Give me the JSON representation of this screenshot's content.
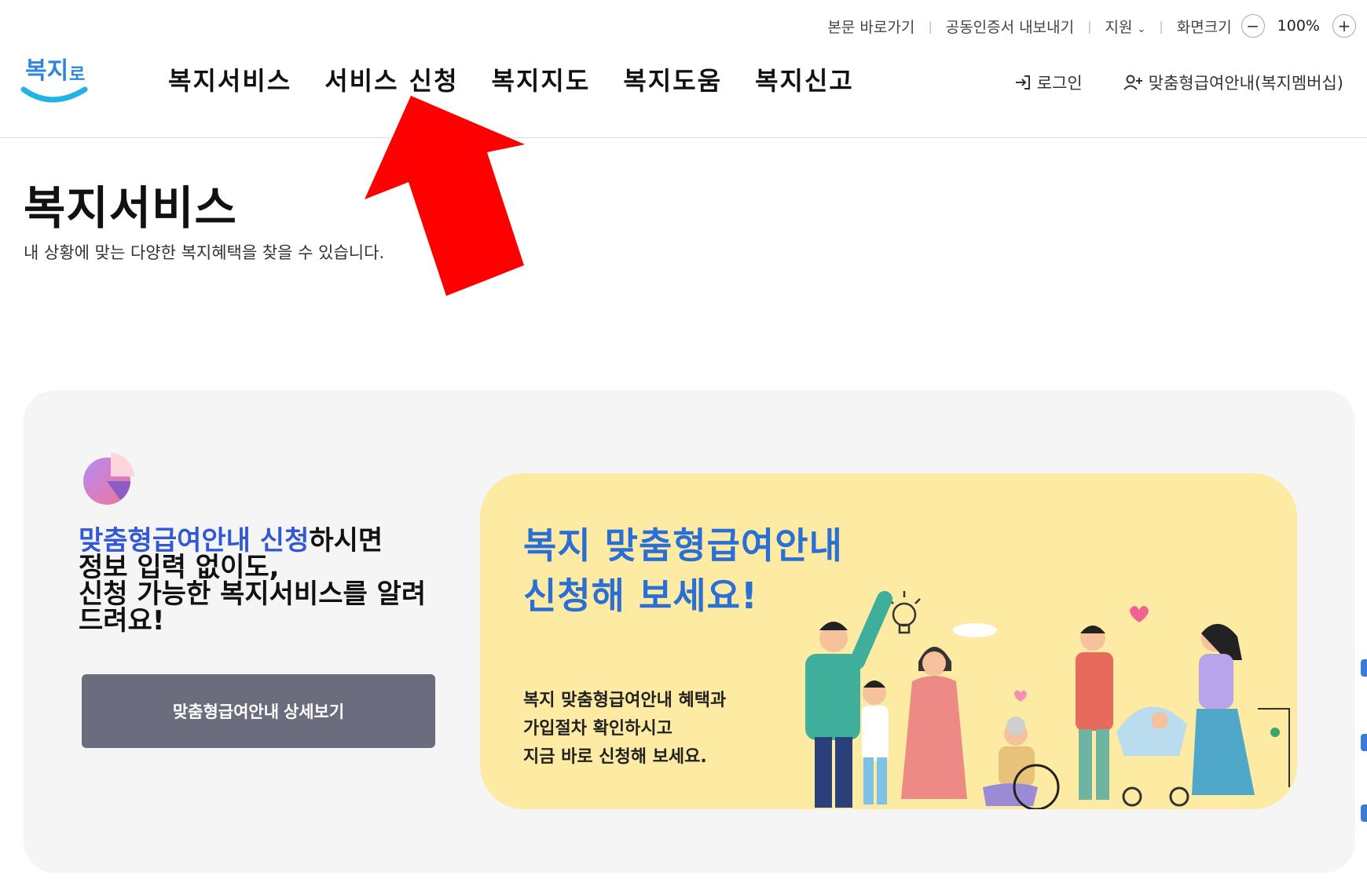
{
  "utility": {
    "skip": "본문 바로가기",
    "cert": "공동인증서 내보내기",
    "support": "지원",
    "screen_size": "화면크기",
    "zoom": "100%",
    "minus": "−",
    "plus": "+"
  },
  "logo": {
    "text": "복지로"
  },
  "nav": {
    "items": [
      "복지서비스",
      "서비스 신청",
      "복지지도",
      "복지도움",
      "복지신고"
    ]
  },
  "account": {
    "login": "로그인",
    "membership": "맞춤형급여안내(복지멤버십)"
  },
  "page": {
    "title": "복지서비스",
    "subtitle": "내 상황에 맞는 다양한 복지혜택을 찾을 수 있습니다."
  },
  "promo": {
    "highlight": "맞춤형급여안내 신청",
    "rest": "하시면",
    "line2": "정보 입력 없이도,",
    "line3": "신청 가능한 복지서비스를 알려",
    "line4": "드려요!",
    "button": "맞춤형급여안내 상세보기"
  },
  "banner": {
    "title1": "복지 맞춤형급여안내",
    "title2": "신청해 보세요!",
    "body1": "복지 맞춤형급여안내 혜택과",
    "body2": "가입절차 확인하시고",
    "body3": "지금 바로 신청해 보세요."
  },
  "colors": {
    "accent_blue": "#3358d4",
    "banner_bg": "#fdeaa3",
    "button_bg": "#6b6c7d",
    "annotation_red": "#ff0000"
  }
}
